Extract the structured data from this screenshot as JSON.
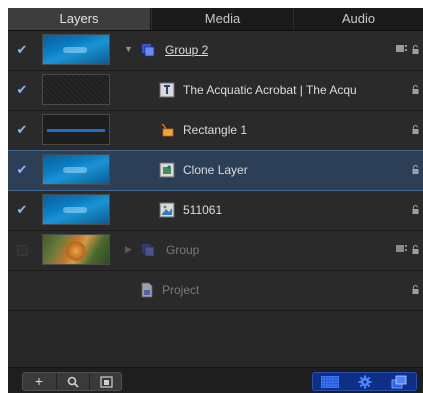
{
  "tabs": [
    {
      "label": "Layers",
      "active": true
    },
    {
      "label": "Media",
      "active": false
    },
    {
      "label": "Audio",
      "active": false
    }
  ],
  "rows": [
    {
      "checked": true,
      "thumbnail": "ocean",
      "disclosure": "expanded",
      "icon": "group-icon",
      "label": "Group 2",
      "selected": false,
      "dim": false,
      "lock_icon": "lock-icon",
      "group_icon": "layer-group-icon"
    },
    {
      "checked": true,
      "thumbnail": "checker",
      "icon": "text-layer-icon",
      "label": "The Acquatic Acrobat | The Acqu",
      "selected": false,
      "dim": false,
      "lock_icon": "lock-icon"
    },
    {
      "checked": true,
      "thumbnail": "bar",
      "icon": "shape-icon",
      "label": "Rectangle 1",
      "selected": false,
      "dim": false,
      "lock_icon": "lock-icon"
    },
    {
      "checked": true,
      "thumbnail": "ocean",
      "icon": "clone-layer-icon",
      "label": "Clone Layer",
      "selected": true,
      "dim": false,
      "lock_icon": "lock-icon"
    },
    {
      "checked": true,
      "thumbnail": "ocean",
      "icon": "image-icon",
      "label": "511061",
      "selected": false,
      "dim": false,
      "lock_icon": "lock-icon"
    },
    {
      "checked": false,
      "thumbnail": "tiger",
      "disclosure": "collapsed",
      "icon": "group-icon",
      "label": "Group",
      "selected": false,
      "dim": true,
      "lock_icon": "lock-icon",
      "group_icon": "layer-group-icon"
    },
    {
      "checked": null,
      "thumbnail": null,
      "icon": "project-icon",
      "label": "Project",
      "selected": false,
      "dim": true,
      "lock_icon": "lock-icon"
    }
  ],
  "footer": {
    "left_buttons": [
      {
        "icon": "add-icon",
        "glyph": "+"
      },
      {
        "icon": "search-icon"
      },
      {
        "icon": "export-icon"
      }
    ],
    "right_buttons": [
      {
        "icon": "checkerboard-icon"
      },
      {
        "icon": "gear-icon"
      },
      {
        "icon": "stack-icon"
      }
    ]
  },
  "colors": {
    "panel_bg": "#272727",
    "selected_row": "#2c3f57",
    "accent_blue": "#0e2f86"
  }
}
